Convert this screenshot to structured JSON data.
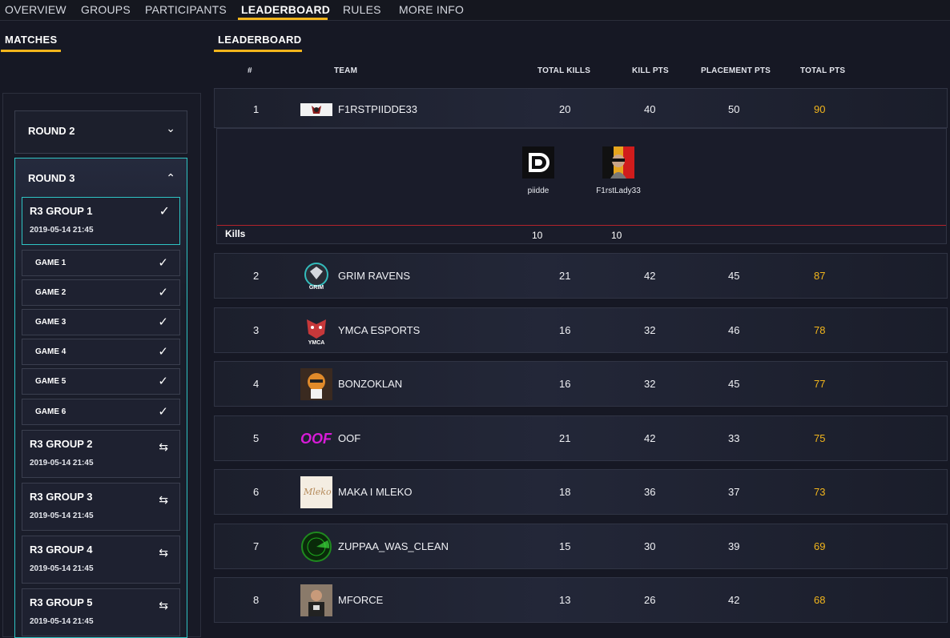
{
  "topnav": {
    "tabs": [
      {
        "label": "OVERVIEW"
      },
      {
        "label": "GROUPS"
      },
      {
        "label": "PARTICIPANTS"
      },
      {
        "label": "LEADERBOARD"
      },
      {
        "label": "RULES"
      },
      {
        "label": "MORE INFO"
      }
    ],
    "active": "LEADERBOARD"
  },
  "sections": {
    "matches_label": "MATCHES",
    "leaderboard_label": "LEADERBOARD"
  },
  "sidebar": {
    "rounds": [
      {
        "title": "ROUND 2",
        "expanded": false
      },
      {
        "title": "ROUND 3",
        "expanded": true
      }
    ],
    "groups": [
      {
        "name": "R3 GROUP 1",
        "date": "2019-05-14 21:45",
        "status": "complete"
      },
      {
        "name": "R3 GROUP 2",
        "date": "2019-05-14 21:45",
        "status": "pending"
      },
      {
        "name": "R3 GROUP 3",
        "date": "2019-05-14 21:45",
        "status": "pending"
      },
      {
        "name": "R3 GROUP 4",
        "date": "2019-05-14 21:45",
        "status": "pending"
      },
      {
        "name": "R3 GROUP 5",
        "date": "2019-05-14 21:45",
        "status": "pending"
      }
    ],
    "games": [
      {
        "label": "GAME 1"
      },
      {
        "label": "GAME 2"
      },
      {
        "label": "GAME 3"
      },
      {
        "label": "GAME 4"
      },
      {
        "label": "GAME 5"
      },
      {
        "label": "GAME 6"
      }
    ]
  },
  "table": {
    "headers": {
      "rank": "#",
      "team": "TEAM",
      "kills": "TOTAL KILLS",
      "kill_pts": "KILL PTS",
      "placement_pts": "PLACEMENT PTS",
      "total_pts": "TOTAL PTS"
    },
    "rows": [
      {
        "rank": "1",
        "team": "F1RSTPIIDDE33",
        "kills": "20",
        "kill_pts": "40",
        "placement_pts": "50",
        "total_pts": "90"
      },
      {
        "rank": "2",
        "team": "GRIM RAVENS",
        "kills": "21",
        "kill_pts": "42",
        "placement_pts": "45",
        "total_pts": "87"
      },
      {
        "rank": "3",
        "team": "YMCA ESPORTS",
        "kills": "16",
        "kill_pts": "32",
        "placement_pts": "46",
        "total_pts": "78"
      },
      {
        "rank": "4",
        "team": "BONZOKLAN",
        "kills": "16",
        "kill_pts": "32",
        "placement_pts": "45",
        "total_pts": "77"
      },
      {
        "rank": "5",
        "team": "OOF",
        "kills": "21",
        "kill_pts": "42",
        "placement_pts": "33",
        "total_pts": "75"
      },
      {
        "rank": "6",
        "team": "MAKA I MLEKO",
        "kills": "18",
        "kill_pts": "36",
        "placement_pts": "37",
        "total_pts": "73"
      },
      {
        "rank": "7",
        "team": "ZUPPAA_WAS_CLEAN",
        "kills": "15",
        "kill_pts": "30",
        "placement_pts": "39",
        "total_pts": "69"
      },
      {
        "rank": "8",
        "team": "MFORCE",
        "kills": "13",
        "kill_pts": "26",
        "placement_pts": "42",
        "total_pts": "68"
      }
    ],
    "expanded": {
      "players": [
        {
          "name": "piidde",
          "kills": "10"
        },
        {
          "name": "F1rstLady33",
          "kills": "10"
        }
      ],
      "kills_label": "Kills"
    },
    "logo_texts": {
      "oof": "OOF",
      "grim": "GRIM",
      "ymca": "YMCA",
      "mleko": "Mleko"
    }
  },
  "colors": {
    "accent": "#f2b51c",
    "teal": "#2ec4c4",
    "kills_divider": "#b3232b",
    "oof_magenta": "#d81bd8"
  }
}
